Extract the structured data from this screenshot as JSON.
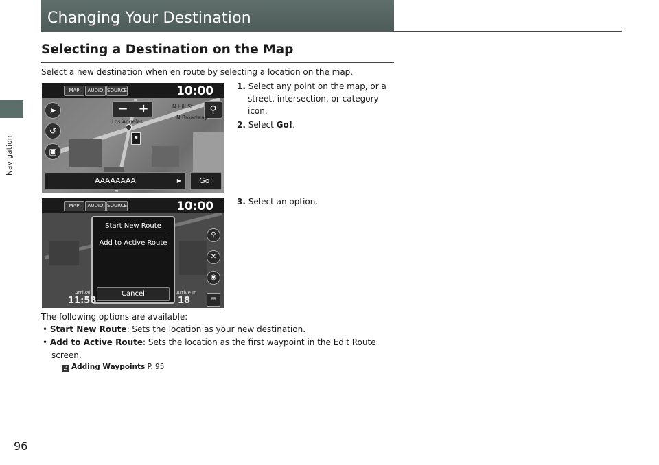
{
  "side_tab_label": "Navigation",
  "page_title": "Changing Your Destination",
  "section_heading": "Selecting a Destination on the Map",
  "intro": "Select a new destination when en route by selecting a location on the map.",
  "screen1": {
    "tabs": [
      "MAP",
      "AUDIO",
      "SOURCE"
    ],
    "clock": "10:00",
    "zoom_out": "−",
    "zoom_in": "+",
    "map_labels": [
      "Los Angeles",
      "N Hill St",
      "N Broadway"
    ],
    "location_name": "AAAAAAAA",
    "go_button": "Go!",
    "icons": [
      "back-arrow-icon",
      "u-turn-icon",
      "map-view-icon",
      "search-icon",
      "flag-icon"
    ]
  },
  "screen2": {
    "tabs": [
      "MAP",
      "AUDIO",
      "SOURCE"
    ],
    "clock": "10:00",
    "options": [
      "Start New Route",
      "Add to Active Route"
    ],
    "cancel": "Cancel",
    "arrival_label": "Arrival",
    "arrival_value": "11:58",
    "arrive_in_label": "Arrive In",
    "arrive_in_value": "18"
  },
  "steps": [
    {
      "num": "1.",
      "line1": "Select any point on the map, or a",
      "line2": "street, intersection, or category",
      "line3": "icon."
    },
    {
      "num": "2.",
      "text": "Select ",
      "target": "Go!",
      "tail": "."
    },
    {
      "num": "3.",
      "text": "Select an option."
    }
  ],
  "options_intro": "The following options are available:",
  "bullets": [
    {
      "term": "Start New Route",
      "desc": ": Sets the location as your new destination."
    },
    {
      "term": "Add to Active Route",
      "desc": ": Sets the location as the first waypoint in the Edit Route",
      "cont": "screen."
    }
  ],
  "xref": {
    "label": "Adding Waypoints",
    "page": "P. 95"
  },
  "page_number": "96"
}
